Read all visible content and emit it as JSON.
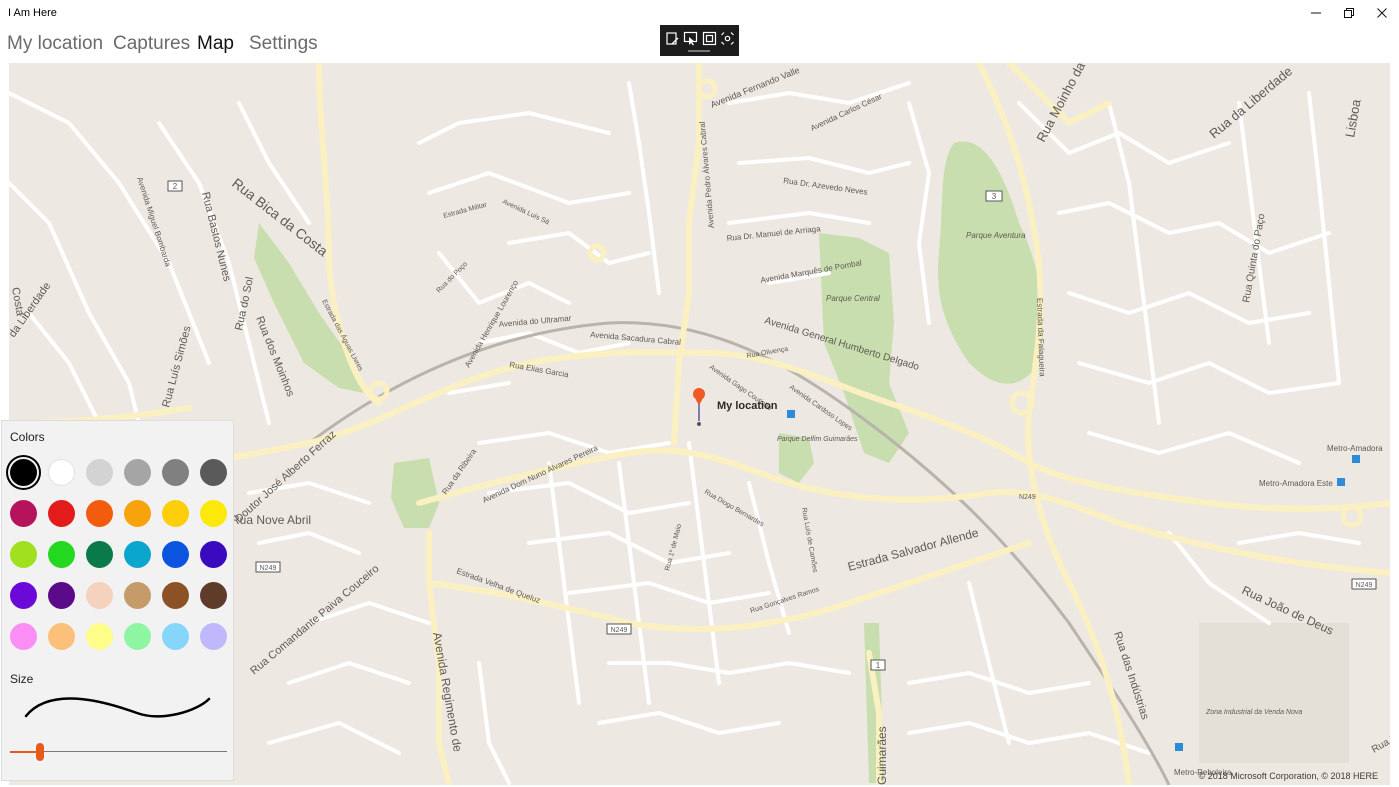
{
  "window": {
    "title": "I Am Here",
    "minimize_icon": "minimize-icon",
    "maximize_icon": "restore-icon",
    "close_icon": "close-icon"
  },
  "nav": {
    "tabs": [
      {
        "label": "My location",
        "active": false
      },
      {
        "label": "Captures",
        "active": false
      },
      {
        "label": "Map",
        "active": true
      },
      {
        "label": "Settings",
        "active": false
      }
    ]
  },
  "ink_toolbar": {
    "tools": [
      "ballpoint-pen-icon",
      "selection-icon",
      "crop-icon",
      "ruler-icon"
    ]
  },
  "map": {
    "pin_label": "My location",
    "attribution": "© 2018 Microsoft Corporation, © 2018 HERE",
    "labels": [
      "Rua Bica da Costa",
      "Avenida Fernando Valle",
      "Rua Moinho da",
      "Rua da Liberdade",
      "Lisboa",
      "Avenida Carlos César",
      "Rua Dr. Azevedo Neves",
      "Rua Dr. Manuel de Arriaga",
      "Avenida Marquês de Pombal",
      "Parque Aventura",
      "Parque Central",
      "Avenida General Humberto Delgado",
      "Avenida do Ultramar",
      "Avenida Sacadura Cabral",
      "Rua Elias Garcia",
      "Avenida Henrique Lourenço",
      "Avenida Pedro Álvares Cabral",
      "Avenida Miguel Bombarda",
      "Rua Bastos Nunes",
      "Rua do Sol",
      "Rua dos Moinhos",
      "Rua Luís Simões",
      "Estrada Militar",
      "Avenida Luís Sá",
      "Rua do Poço",
      "Rua Olivença",
      "Avenida Gago Coutinho",
      "Avenida Cardoso Lopes",
      "Parque Delfim Guimarães",
      "Avenida Dom Nuno Álvares Pereira",
      "Rua da Ribeira",
      "Rua Diogo Bernardes",
      "Rua Nove Abril",
      "N249",
      "Estrada Salvador Allende",
      "Rua João de Deus",
      "Rua das Indústrias",
      "Zona Industrial da Venda Nova",
      "Metro-Amadora",
      "Metro-Amadora Este",
      "Metro-Reboleira",
      "Estrada Velha de Queluz",
      "Rua Gonçalves Ramos",
      "Avenida Regimento de",
      "Rua Comandante Paiva Couceiro",
      "Guimarães",
      "Estrada das Águas Livres",
      "Rua Quinta do Paço",
      "Estrada da Falagueira",
      "Doutor José Alberto Ferraz",
      "da Liberdade",
      "Costa",
      "Rua 1º de Maio",
      "Rua Luís de Camões",
      "Rua Dr"
    ],
    "shields": [
      "2",
      "3",
      "1"
    ]
  },
  "panel": {
    "colors_label": "Colors",
    "size_label": "Size",
    "colors": [
      "#000000",
      "#ffffff",
      "#d3d3d3",
      "#a5a5a5",
      "#808080",
      "#5a5a5a",
      "#b5145d",
      "#e21b1b",
      "#f35b0d",
      "#f7a30b",
      "#fccf0a",
      "#fde80c",
      "#a1e01e",
      "#23d81f",
      "#0a7a4b",
      "#0aa6cd",
      "#0a54e0",
      "#3b0abe",
      "#6b0ad8",
      "#5b0a8a",
      "#f4d2bd",
      "#c59b6a",
      "#8c5225",
      "#5f3b2a",
      "#fa8ef5",
      "#fdc07a",
      "#fdfd8a",
      "#8ef5a3",
      "#86d6fb",
      "#bfb8fb"
    ],
    "selected_color": "#000000",
    "size_value": 0.14,
    "accent": "#e85a1b"
  }
}
